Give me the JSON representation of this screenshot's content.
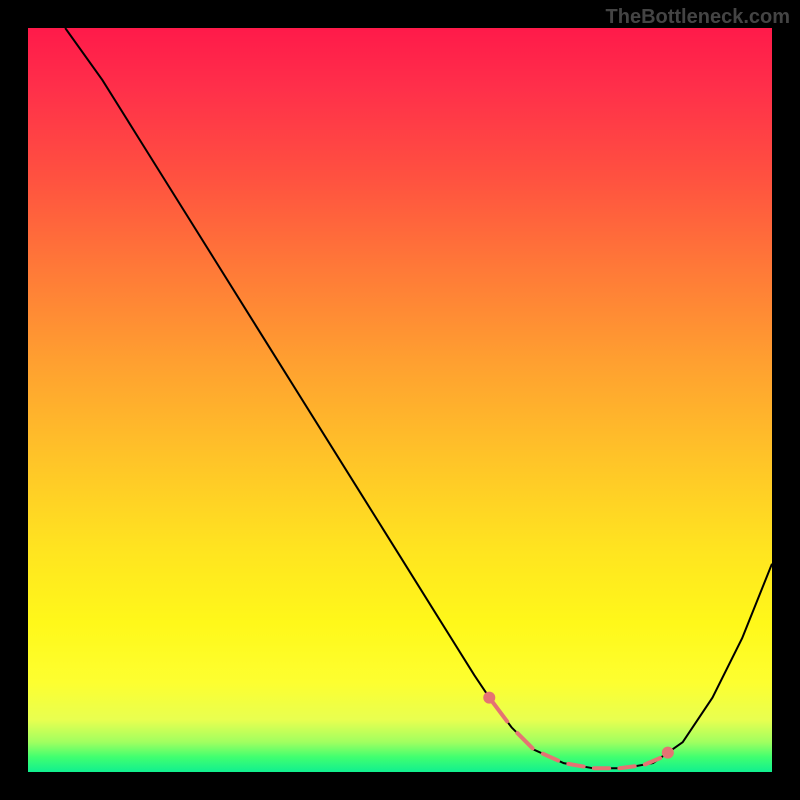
{
  "watermark": "TheBottleneck.com",
  "chart_data": {
    "type": "line",
    "title": "",
    "xlabel": "",
    "ylabel": "",
    "xlim": [
      0,
      100
    ],
    "ylim": [
      0,
      100
    ],
    "series": [
      {
        "name": "curve",
        "x": [
          5,
          10,
          15,
          20,
          25,
          30,
          35,
          40,
          45,
          50,
          55,
          60,
          62,
          65,
          68,
          72,
          76,
          80,
          84,
          88,
          92,
          96,
          100
        ],
        "values": [
          100,
          93,
          85,
          77,
          69,
          61,
          53,
          45,
          37,
          29,
          21,
          13,
          10,
          6,
          3,
          1.2,
          0.5,
          0.5,
          1.2,
          4,
          10,
          18,
          28
        ]
      }
    ],
    "highlight_range_x": [
      62,
      86
    ],
    "annotations": []
  }
}
